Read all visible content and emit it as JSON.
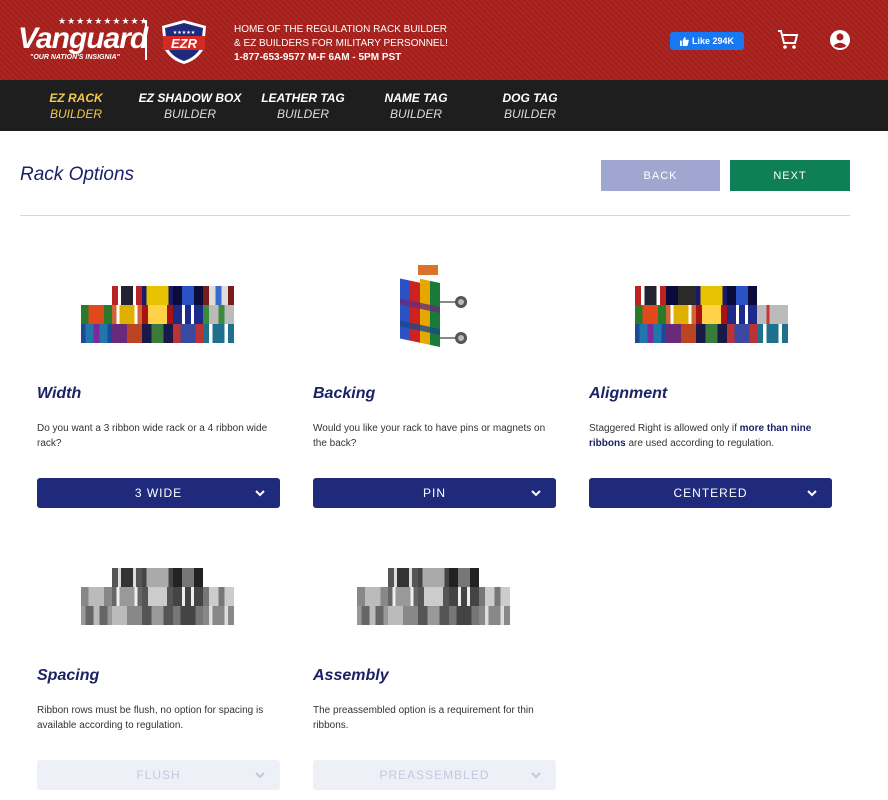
{
  "header": {
    "logo": {
      "stars": "★★★★★★★★★★",
      "brand": "Vanguard",
      "tagline": "\"OUR NATION'S INSIGNIA\""
    },
    "badge": {
      "text": "EZR",
      "stars": "★★★★★"
    },
    "info": {
      "line1": "HOME OF THE REGULATION RACK BUILDER",
      "line2": "& EZ BUILDERS FOR MILITARY PERSONNEL!",
      "phone": "1-877-653-9577 M-F 6AM - 5PM PST"
    },
    "fb_like": {
      "label": "Like 294K"
    },
    "icons": {
      "cart": "cart-icon",
      "account": "user-icon"
    },
    "colors": {
      "header_bg": "#a8201c",
      "nav_bg": "#1e1e1e",
      "active_nav": "#f2c94c"
    }
  },
  "nav": {
    "items": [
      {
        "line1": "EZ RACK",
        "line2": "BUILDER",
        "active": true
      },
      {
        "line1": "EZ SHADOW BOX",
        "line2": "BUILDER",
        "active": false
      },
      {
        "line1": "LEATHER TAG",
        "line2": "BUILDER",
        "active": false
      },
      {
        "line1": "NAME TAG",
        "line2": "BUILDER",
        "active": false
      },
      {
        "line1": "DOG TAG",
        "line2": "BUILDER",
        "active": false
      }
    ]
  },
  "page": {
    "title": "Rack Options",
    "back_label": "BACK",
    "next_label": "NEXT",
    "colors": {
      "back": "#9fa6cf",
      "next": "#0f8055",
      "select": "#1f2a7c"
    }
  },
  "options": {
    "width": {
      "title": "Width",
      "description": "Do you want a 3 ribbon wide rack or a 4 ribbon wide rack?",
      "value": "3 WIDE",
      "enabled": true
    },
    "backing": {
      "title": "Backing",
      "description": "Would you like your rack to have pins or magnets on the back?",
      "value": "PIN",
      "enabled": true
    },
    "alignment": {
      "title": "Alignment",
      "desc_pre": "Staggered Right is allowed only if ",
      "desc_bold": "more than nine ribbons",
      "desc_post": " are used according to regulation.",
      "value": "CENTERED",
      "enabled": true
    },
    "spacing": {
      "title": "Spacing",
      "description": "Ribbon rows must be flush, no option for spacing is available according to regulation.",
      "value": "FLUSH",
      "enabled": false
    },
    "assembly": {
      "title": "Assembly",
      "description": "The preassembled option is a requirement for thin ribbons.",
      "value": "PREASSEMBLED",
      "enabled": false
    }
  }
}
